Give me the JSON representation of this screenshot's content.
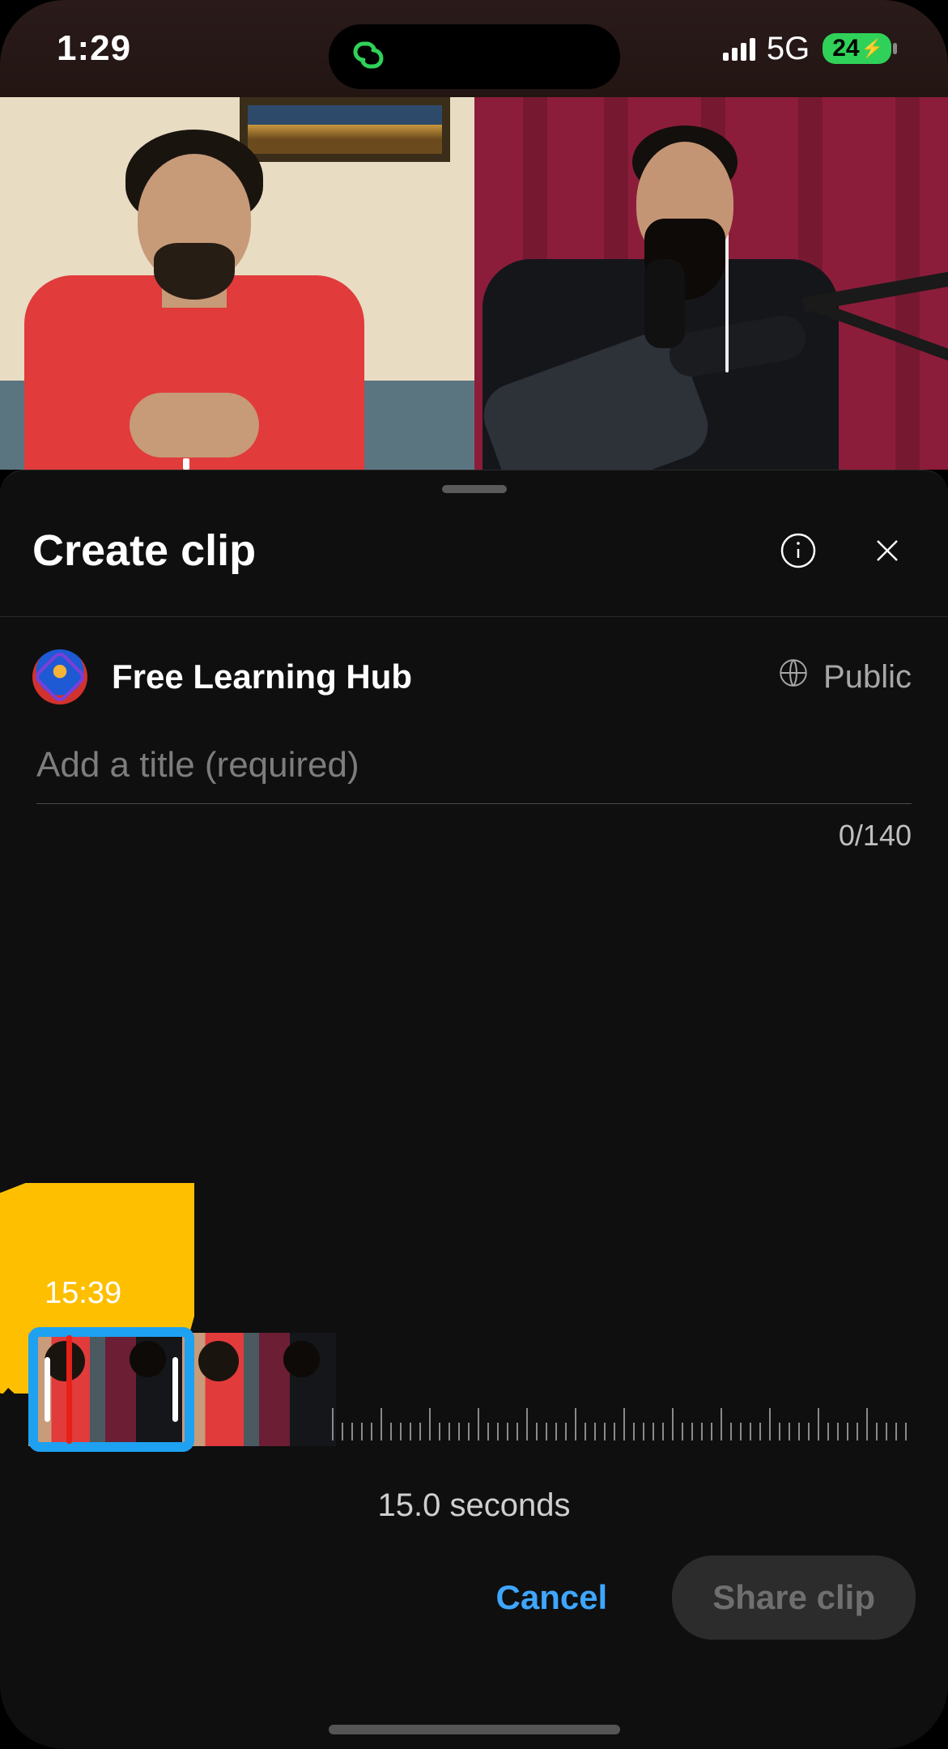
{
  "status": {
    "time": "1:29",
    "network": "5G",
    "battery": "24"
  },
  "sheet": {
    "title": "Create clip",
    "channel": "Free Learning Hub",
    "visibility": "Public",
    "title_placeholder": "Add a title (required)",
    "title_value": "",
    "char_count": "0/140",
    "timeline_time": "15:39",
    "duration": "15.0 seconds",
    "cancel": "Cancel",
    "share": "Share clip"
  }
}
